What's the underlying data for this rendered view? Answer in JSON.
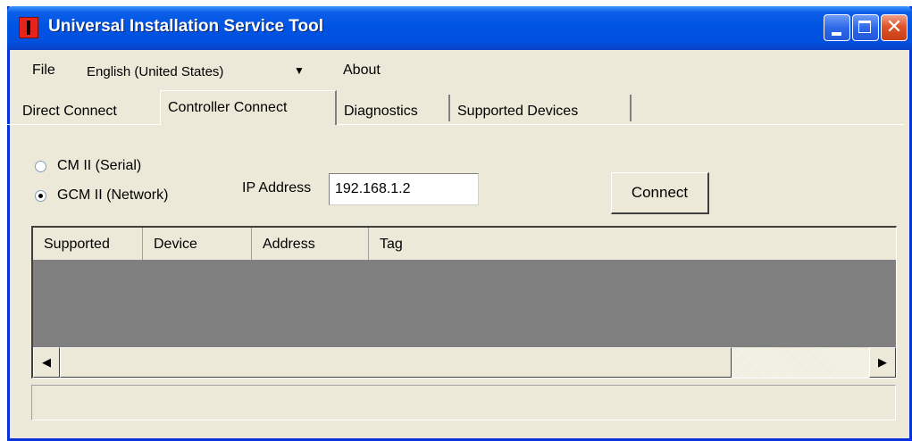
{
  "window": {
    "title": "Universal Installation Service Tool",
    "colors": {
      "titlebar": "#0054e3",
      "face": "#ece9d8",
      "close": "#e0542a"
    },
    "controls": {
      "close_glyph": "✕"
    }
  },
  "menu": {
    "file": "File",
    "language": "English (United States)",
    "about": "About",
    "dropdown_arrow": "▼"
  },
  "tabs": [
    {
      "label": "Direct Connect",
      "active": false
    },
    {
      "label": "Controller Connect",
      "active": true
    },
    {
      "label": "Diagnostics",
      "active": false
    },
    {
      "label": "Supported Devices",
      "active": false
    }
  ],
  "connection": {
    "options": [
      {
        "label": "CM II (Serial)",
        "selected": false
      },
      {
        "label": "GCM II (Network)",
        "selected": true
      }
    ],
    "ip_label": "IP Address",
    "ip_value": "192.168.1.2",
    "connect_label": "Connect"
  },
  "table": {
    "columns": [
      "Supported",
      "Device",
      "Address",
      "Tag"
    ],
    "rows": []
  },
  "scrollbar": {
    "left_arrow": "◀",
    "right_arrow": "▶"
  },
  "status": {
    "text": ""
  }
}
